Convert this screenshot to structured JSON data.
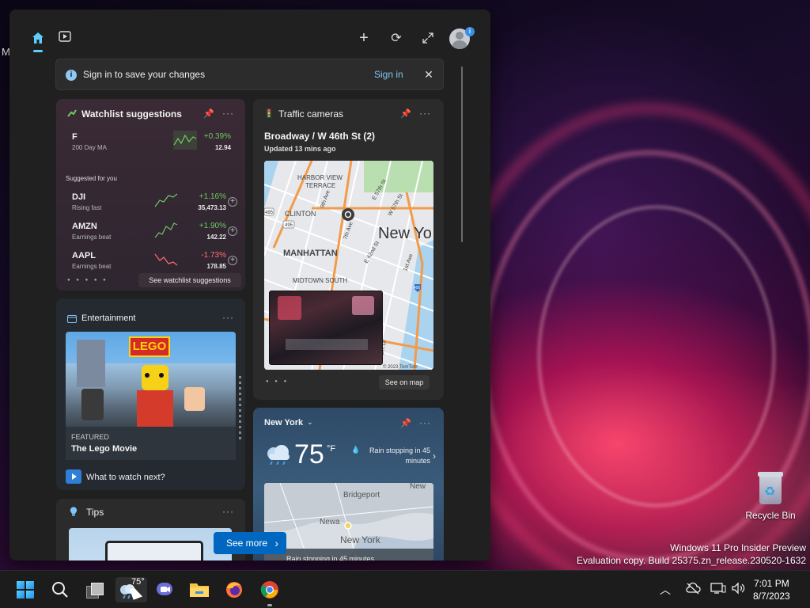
{
  "desktop": {
    "stray_letter": "M",
    "recycle_bin_label": "Recycle Bin",
    "watermark": {
      "line1": "Windows 11 Pro Insider Preview",
      "line2": "Evaluation copy. Build 25375.zn_release.230520-1632"
    }
  },
  "widgets": {
    "signin_bar": {
      "message": "Sign in to save your changes",
      "link": "Sign in"
    },
    "watchlist": {
      "title": "Watchlist suggestions",
      "top_stock": {
        "symbol": "F",
        "sub": "200 Day MA",
        "change": "+0.39%",
        "value": "12.94",
        "color": "#6ccb5f"
      },
      "suggested_label": "Suggested for you",
      "stocks": [
        {
          "symbol": "DJI",
          "sub": "Rising fast",
          "change": "+1.16%",
          "value": "35,473.13",
          "color": "#6ccb5f"
        },
        {
          "symbol": "AMZN",
          "sub": "Earnings beat",
          "change": "+1.90%",
          "value": "142.22",
          "color": "#6ccb5f"
        },
        {
          "symbol": "AAPL",
          "sub": "Earnings beat",
          "change": "-1.73%",
          "value": "178.85",
          "color": "#ff6f6f"
        }
      ],
      "see_more": "See watchlist suggestions"
    },
    "traffic": {
      "title": "Traffic cameras",
      "place": "Broadway / W 46th St (2)",
      "updated": "Updated 13 mins ago",
      "map_labels": {
        "harbor": "HARBOR VIEW",
        "terrace": "TERRACE",
        "clinton": "CLINTON",
        "manhattan": "MANHATTAN",
        "newyork": "New Yo",
        "midtown": "MIDTOWN SOUTH",
        "e57": "E 57th St",
        "w57": "W 57th St",
        "e42": "E 42nd St",
        "ave9": "9th Ave",
        "ave7": "7th Ave",
        "ave1": "1st Ave",
        "fdr": "FDR Dr",
        "i495": "495",
        "i495b": "495",
        "road_495": "495",
        "copyright": "© 2023 TomTom"
      },
      "see_map": "See on map"
    },
    "entertainment": {
      "title": "Entertainment",
      "logo": "LEGO",
      "tagline": "FEATURED",
      "movie": "The Lego Movie",
      "cta": "What to watch next?"
    },
    "weather": {
      "city": "New York",
      "temp": "75",
      "unit": "°F",
      "rain": "Rain stopping in 45 minutes",
      "map_labels": {
        "bridgeport": "Bridgeport",
        "newark": "Newa",
        "newyork": "New York",
        "new": "New"
      },
      "map_footer": "Rain stopping in 45 minutes"
    },
    "tips": {
      "title": "Tips"
    },
    "see_more": "See more"
  },
  "taskbar": {
    "widget_temp": "75°",
    "clock_time": "7:01 PM",
    "clock_date": "8/7/2023"
  }
}
